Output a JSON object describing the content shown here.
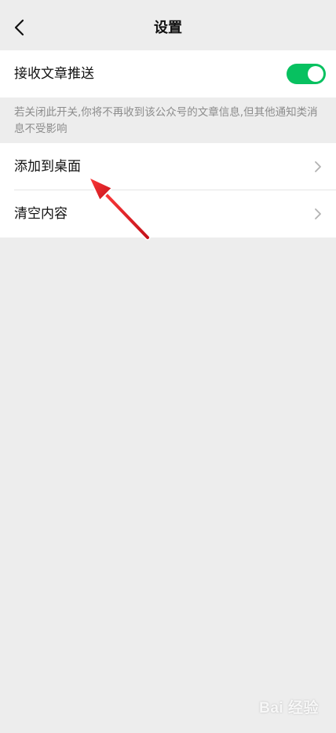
{
  "header": {
    "title": "设置",
    "back_icon": "chevron-left-icon"
  },
  "push_setting": {
    "label": "接收文章推送",
    "toggle_on": true,
    "toggle_color": "#07c160",
    "hint": "若关闭此开关,你将不再收到该公众号的文章信息,但其他通知类消息不受影响"
  },
  "menu": {
    "items": [
      {
        "label": "添加到桌面",
        "icon": "chevron-right-icon"
      },
      {
        "label": "清空内容",
        "icon": "chevron-right-icon"
      }
    ]
  },
  "annotation": {
    "arrow_color": "#e8222a",
    "target": "添加到桌面"
  },
  "watermark": {
    "text": "Bai 经验"
  }
}
